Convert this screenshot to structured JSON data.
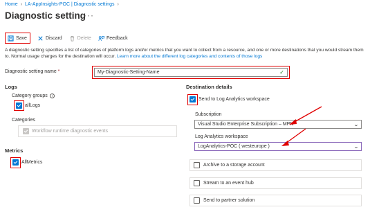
{
  "breadcrumb": {
    "items": [
      "Home",
      "LA-AppInsights-POC | Diagnostic settings"
    ]
  },
  "page": {
    "title": "Diagnostic setting",
    "more": "···"
  },
  "toolbar": {
    "save_label": "Save",
    "discard_label": "Discard",
    "delete_label": "Delete",
    "feedback_label": "Feedback"
  },
  "description": {
    "text": "A diagnostic setting specifies a list of categories of platform logs and/or metrics that you want to collect from a resource, and one or more destinations that you would stream them to. Normal usage charges for the destination will occur. ",
    "link": "Learn more about the different log categories and contents of those logs"
  },
  "setting_name": {
    "label": "Diagnostic setting name",
    "required_mark": "*",
    "value": "My-Diagnostic-Setting-Name"
  },
  "logs": {
    "heading": "Logs",
    "category_groups_label": "Category groups",
    "all_logs_label": "allLogs",
    "categories_label": "Categories",
    "workflow_label": "Workflow runtime diagnostic events"
  },
  "metrics": {
    "heading": "Metrics",
    "all_metrics_label": "AllMetrics"
  },
  "destination": {
    "heading": "Destination details",
    "send_to_la_label": "Send to Log Analytics workspace",
    "subscription_label": "Subscription",
    "subscription_value": "Visual Studio Enterprise Subscription – MPN",
    "workspace_label": "Log Analytics workspace",
    "workspace_value": "LogAnalytics-POC ( westeurope )",
    "archive_label": "Archive to a storage account",
    "event_hub_label": "Stream to an event hub",
    "partner_label": "Send to partner solution"
  },
  "colors": {
    "accent": "#0078d4",
    "annotation": "#e00000",
    "valid": "#107c10"
  }
}
